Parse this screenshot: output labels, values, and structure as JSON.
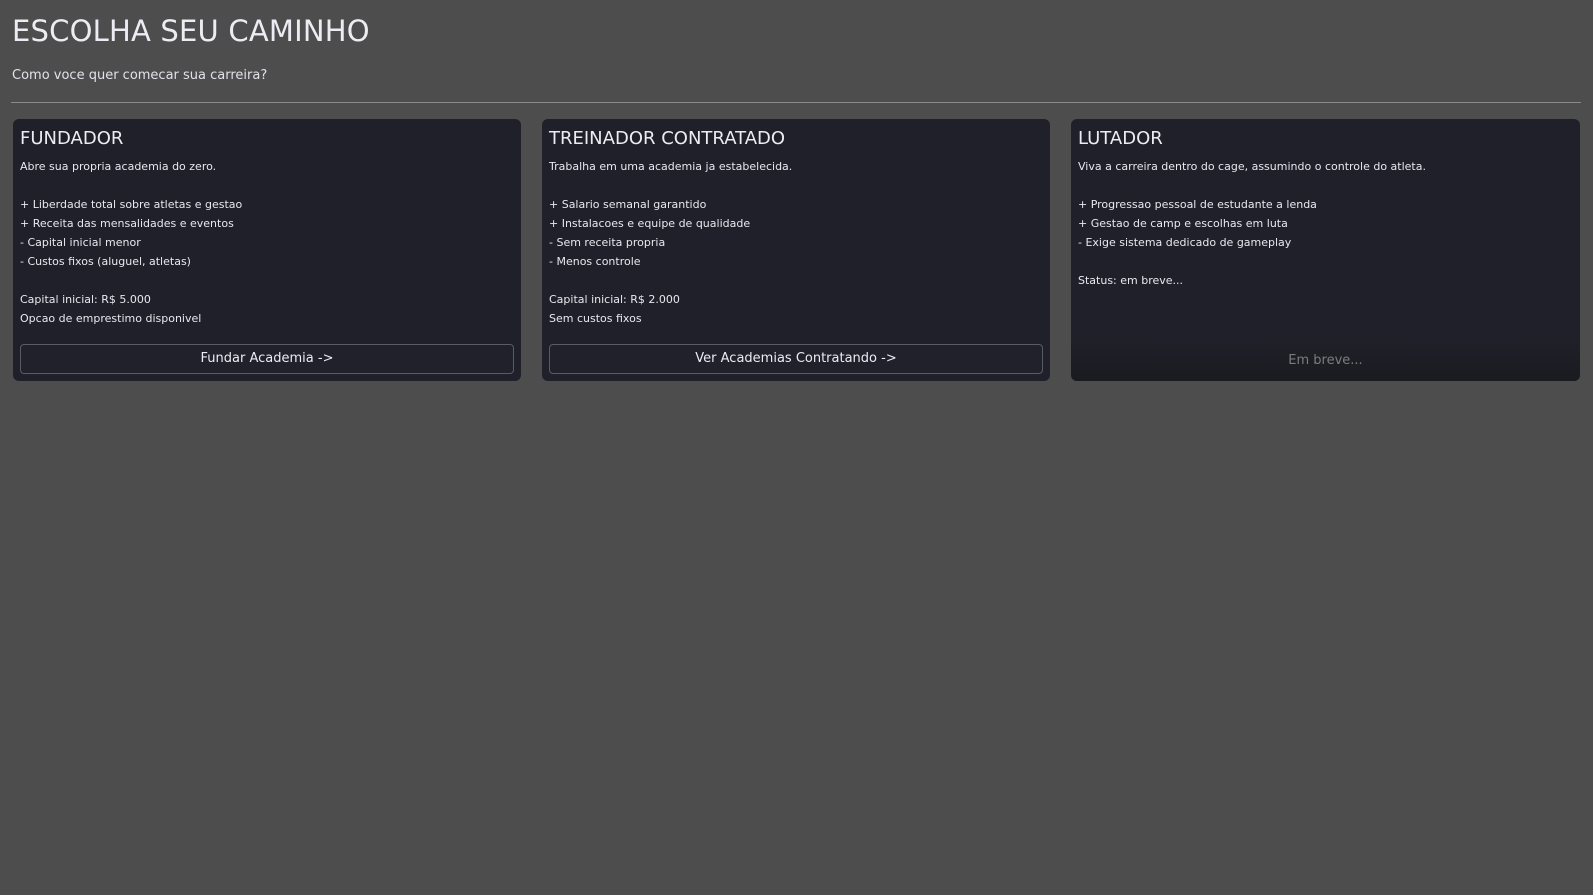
{
  "header": {
    "title": "ESCOLHA SEU CAMINHO",
    "subtitle": "Como voce quer comecar sua carreira?"
  },
  "cards": [
    {
      "title": "FUNDADOR",
      "lines": [
        "Abre sua propria academia do zero.",
        "",
        "+ Liberdade total sobre atletas e gestao",
        "+ Receita das mensalidades e eventos",
        "- Capital inicial menor",
        "- Custos fixos (aluguel, atletas)",
        "",
        "Capital inicial: R$ 5.000",
        "Opcao de emprestimo disponivel"
      ],
      "button_label": "Fundar Academia ->",
      "button_enabled": true
    },
    {
      "title": "TREINADOR CONTRATADO",
      "lines": [
        "Trabalha em uma academia ja estabelecida.",
        "",
        "+ Salario semanal garantido",
        "+ Instalacoes e equipe de qualidade",
        "- Sem receita propria",
        "- Menos controle",
        "",
        "Capital inicial: R$ 2.000",
        "Sem custos fixos"
      ],
      "button_label": "Ver Academias Contratando ->",
      "button_enabled": true
    },
    {
      "title": "LUTADOR",
      "lines": [
        "Viva a carreira dentro do cage, assumindo o controle do atleta.",
        "",
        "+ Progressao pessoal de estudante a lenda",
        "+ Gestao de camp e escolhas em luta",
        "- Exige sistema dedicado de gameplay",
        "",
        "Status: em breve..."
      ],
      "button_label": "Em breve...",
      "button_enabled": false
    }
  ]
}
